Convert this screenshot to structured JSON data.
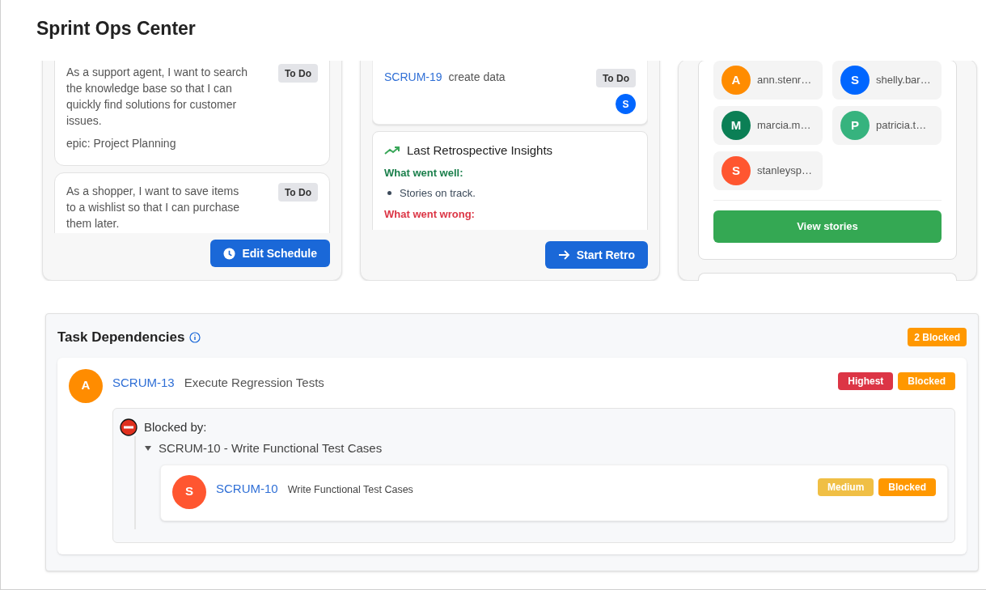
{
  "header": {
    "title": "Sprint Ops Center"
  },
  "stories_panel": {
    "stories": [
      {
        "text": "As a support agent, I want to search the knowledge base so that I can quickly find solutions for customer issues.",
        "status": "To Do",
        "epic": "epic: Project Planning"
      },
      {
        "text": "As a shopper, I want to save items to a wishlist so that I can purchase them later.",
        "status": "To Do"
      }
    ],
    "button": "Edit Schedule"
  },
  "issues_panel": {
    "issues": [
      {
        "key": "SCRUM-19",
        "title": "create data",
        "status": "To Do",
        "assignee": "S",
        "color": "#0066ff"
      }
    ],
    "retro": {
      "title": "Last Retrospective Insights",
      "sections": [
        {
          "kind": "well",
          "heading": "What went well:",
          "items": [
            "Stories on track."
          ]
        },
        {
          "kind": "wrong",
          "heading": "What went wrong:"
        }
      ]
    },
    "button": "Start Retro"
  },
  "team_panel": {
    "members": [
      {
        "initial": "A",
        "name": "ann.stenr…",
        "color": "#ff8c00"
      },
      {
        "initial": "S",
        "name": "shelly.bar…",
        "color": "#0066ff"
      },
      {
        "initial": "M",
        "name": "marcia.m…",
        "color": "#0b7f55"
      },
      {
        "initial": "P",
        "name": "patricia.t…",
        "color": "#36b37e"
      },
      {
        "initial": "S",
        "name": "stanleysp…",
        "color": "#ff5630"
      }
    ],
    "button": "View stories"
  },
  "dependencies": {
    "title": "Task Dependencies",
    "count_badge": "2 Blocked",
    "tasks": [
      {
        "assignee": "A",
        "color": "#ff8c00",
        "key": "SCRUM-13",
        "title": "Execute Regression Tests",
        "badges": [
          {
            "text": "Highest",
            "color": "#dc3545"
          },
          {
            "text": "Blocked",
            "color": "#ff9800"
          }
        ],
        "blocked_by_label": "Blocked by:",
        "blockers": [
          {
            "label": "SCRUM-10 - Write Functional Test Cases",
            "expanded": true,
            "task": {
              "assignee": "S",
              "color": "#ff5630",
              "key": "SCRUM-10",
              "title": "Write Functional Test Cases",
              "badges": [
                {
                  "text": "Medium",
                  "color": "#f0bf45"
                },
                {
                  "text": "Blocked",
                  "color": "#ff9800"
                }
              ]
            }
          }
        ]
      }
    ]
  }
}
